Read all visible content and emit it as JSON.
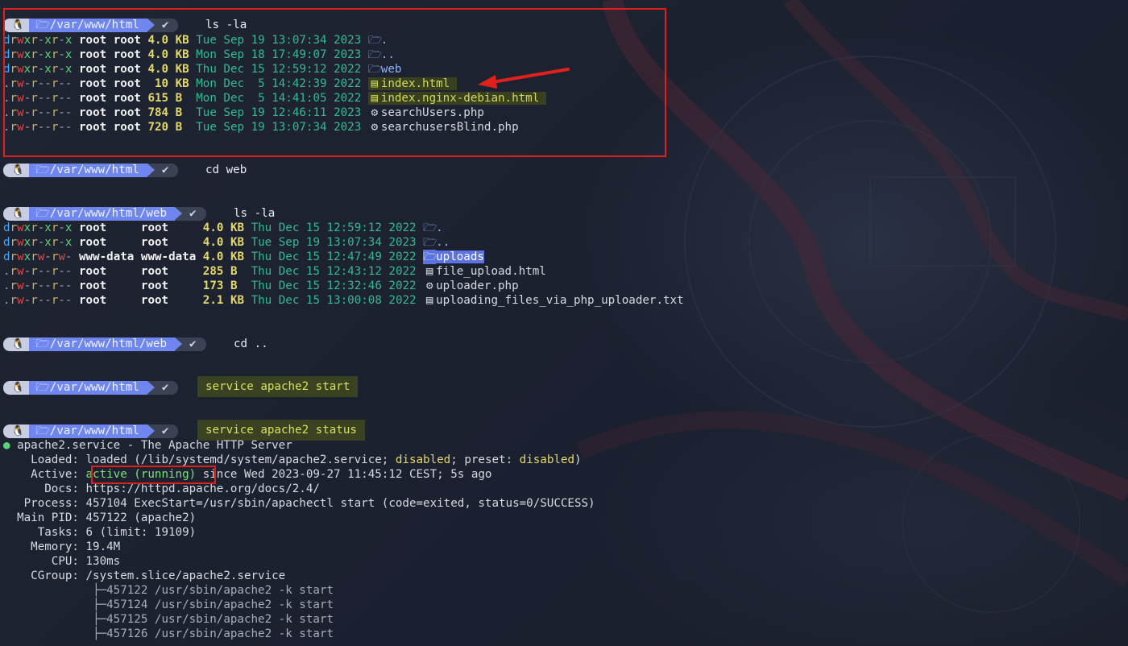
{
  "prompt": {
    "os_icon": "linux-penguin-icon",
    "check": "✔"
  },
  "block1": {
    "path": "/var/www/html",
    "command": "ls -la",
    "rows": [
      {
        "perms": "drwxr-xr-x",
        "user": "root",
        "group": "root",
        "size": "4.0 KB",
        "date": "Tue Sep 19 13:07:34 2023",
        "icon": "folder-icon",
        "name": "."
      },
      {
        "perms": "drwxr-xr-x",
        "user": "root",
        "group": "root",
        "size": "4.0 KB",
        "date": "Mon Sep 18 17:49:07 2023",
        "icon": "folder-icon",
        "name": ".."
      },
      {
        "perms": "drwxr-xr-x",
        "user": "root",
        "group": "root",
        "size": "4.0 KB",
        "date": "Thu Dec 15 12:59:12 2022",
        "icon": "folder-icon",
        "name": "web"
      },
      {
        "perms": ".rw-r--r--",
        "user": "root",
        "group": "root",
        "size": " 10 KB",
        "date": "Mon Dec  5 14:42:39 2022",
        "icon": "html-file-icon",
        "name": "index.html"
      },
      {
        "perms": ".rw-r--r--",
        "user": "root",
        "group": "root",
        "size": "615 B ",
        "date": "Mon Dec  5 14:41:05 2022",
        "icon": "html-file-icon",
        "name": "index.nginx-debian.html"
      },
      {
        "perms": ".rw-r--r--",
        "user": "root",
        "group": "root",
        "size": "784 B ",
        "date": "Tue Sep 19 12:46:11 2023",
        "icon": "php-icon",
        "name": "searchUsers.php"
      },
      {
        "perms": ".rw-r--r--",
        "user": "root",
        "group": "root",
        "size": "720 B ",
        "date": "Tue Sep 19 13:07:34 2023",
        "icon": "php-icon",
        "name": "searchusersBlind.php"
      }
    ]
  },
  "block2": {
    "path": "/var/www/html",
    "command": "cd web"
  },
  "block3": {
    "path": "/var/www/html/web",
    "command": "ls -la",
    "rows": [
      {
        "perms": "drwxr-xr-x",
        "user": "root    ",
        "group": "root    ",
        "size": "4.0 KB",
        "date": "Thu Dec 15 12:59:12 2022",
        "icon": "folder-icon",
        "name": "."
      },
      {
        "perms": "drwxr-xr-x",
        "user": "root    ",
        "group": "root    ",
        "size": "4.0 KB",
        "date": "Tue Sep 19 13:07:34 2023",
        "icon": "folder-icon",
        "name": ".."
      },
      {
        "perms": "drwxrw-rw-",
        "user": "www-data",
        "group": "www-data",
        "size": "4.0 KB",
        "date": "Thu Dec 15 12:47:49 2022",
        "icon": "folder-icon",
        "name": "uploads"
      },
      {
        "perms": ".rw-r--r--",
        "user": "root    ",
        "group": "root    ",
        "size": "285 B ",
        "date": "Thu Dec 15 12:43:12 2022",
        "icon": "html-file-icon",
        "name": "file_upload.html"
      },
      {
        "perms": ".rw-r--r--",
        "user": "root    ",
        "group": "root    ",
        "size": "173 B ",
        "date": "Thu Dec 15 12:32:46 2022",
        "icon": "php-icon",
        "name": "uploader.php"
      },
      {
        "perms": ".rw-r--r--",
        "user": "root    ",
        "group": "root    ",
        "size": "2.1 KB",
        "date": "Thu Dec 15 13:00:08 2022",
        "icon": "text-file-icon",
        "name": "uploading_files_via_php_uploader.txt"
      }
    ]
  },
  "block4": {
    "path": "/var/www/html/web",
    "command": "cd .."
  },
  "block5": {
    "path": "/var/www/html",
    "command": "service apache2 start"
  },
  "block6": {
    "path": "/var/www/html",
    "command": "service apache2 status",
    "status": {
      "bullet": "●",
      "title": "apache2.service - The Apache HTTP Server",
      "loaded_label": "Loaded:",
      "loaded_a": "loaded (/lib/systemd/system/apache2.service; ",
      "loaded_b": "disabled",
      "loaded_c": "; preset: ",
      "loaded_d": "disabled",
      "loaded_e": ")",
      "active_label": "Active:",
      "active_state": "active (running)",
      "active_rest": " since Wed 2023-09-27 11:45:12 CEST; 5s ago",
      "docs_label": "Docs:",
      "docs": "https://httpd.apache.org/docs/2.4/",
      "process_label": "Process:",
      "process": "457104 ExecStart=/usr/sbin/apachectl start (code=exited, status=0/SUCCESS)",
      "pid_label": "Main PID:",
      "pid": "457122 (apache2)",
      "tasks_label": "Tasks:",
      "tasks": "6 (limit: 19109)",
      "memory_label": "Memory:",
      "memory": "19.4M",
      "cpu_label": "CPU:",
      "cpu": "130ms",
      "cgroup_label": "CGroup:",
      "cgroup": "/system.slice/apache2.service",
      "procs": [
        "├─457122 /usr/sbin/apache2 -k start",
        "├─457124 /usr/sbin/apache2 -k start",
        "├─457125 /usr/sbin/apache2 -k start",
        "├─457126 /usr/sbin/apache2 -k start"
      ]
    }
  },
  "colors": {
    "highlight_box": "#e0201d",
    "arrow": "#e0201d",
    "prompt_path_bg": "#6f86ee"
  }
}
